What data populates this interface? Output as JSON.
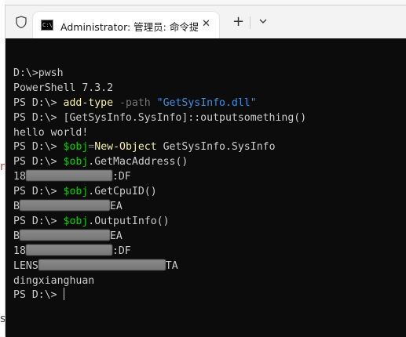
{
  "window": {
    "tab_title": "Administrator: 管理员: 命令提",
    "tab_icon_text": "C:\\."
  },
  "background": {
    "glyph_top": "n",
    "glyph_bottom": "s"
  },
  "terminal": {
    "lines": [
      {
        "segments": [
          {
            "t": "",
            "c": ""
          }
        ]
      },
      {
        "segments": [
          {
            "t": "D:\\>pwsh",
            "c": ""
          }
        ]
      },
      {
        "segments": [
          {
            "t": "PowerShell 7.3.2",
            "c": ""
          }
        ]
      },
      {
        "segments": [
          {
            "t": "PS D:\\> ",
            "c": ""
          },
          {
            "t": "add-type",
            "c": "yellow"
          },
          {
            "t": " -path ",
            "c": "gray"
          },
          {
            "t": "\"GetSysInfo.dll\"",
            "c": "blue"
          }
        ]
      },
      {
        "segments": [
          {
            "t": "PS D:\\> [GetSysInfo.SysInfo]::outputsomething()",
            "c": ""
          }
        ]
      },
      {
        "segments": [
          {
            "t": "hello world!",
            "c": ""
          }
        ]
      },
      {
        "segments": [
          {
            "t": "PS D:\\> ",
            "c": ""
          },
          {
            "t": "$obj",
            "c": "green"
          },
          {
            "t": "=",
            "c": "gray"
          },
          {
            "t": "New-Object",
            "c": "yellow"
          },
          {
            "t": " GetSysInfo.SysInfo",
            "c": ""
          }
        ]
      },
      {
        "segments": [
          {
            "t": "PS D:\\> ",
            "c": ""
          },
          {
            "t": "$obj",
            "c": "green"
          },
          {
            "t": ".GetMacAddress()",
            "c": ""
          }
        ]
      },
      {
        "segments": [
          {
            "t": "18",
            "c": ""
          },
          {
            "blur": 110
          },
          {
            "t": ":DF",
            "c": ""
          }
        ]
      },
      {
        "segments": [
          {
            "t": "PS D:\\> ",
            "c": ""
          },
          {
            "t": "$obj",
            "c": "green"
          },
          {
            "t": ".GetCpuID()",
            "c": ""
          }
        ]
      },
      {
        "segments": [
          {
            "t": "B",
            "c": ""
          },
          {
            "blur": 115
          },
          {
            "t": "EA",
            "c": ""
          }
        ]
      },
      {
        "segments": [
          {
            "t": "PS D:\\> ",
            "c": ""
          },
          {
            "t": "$obj",
            "c": "green"
          },
          {
            "t": ".OutputInfo()",
            "c": ""
          }
        ]
      },
      {
        "segments": [
          {
            "t": "B",
            "c": ""
          },
          {
            "blur": 115
          },
          {
            "t": "EA",
            "c": ""
          }
        ]
      },
      {
        "segments": [
          {
            "t": "18",
            "c": ""
          },
          {
            "blur": 110
          },
          {
            "t": ":DF",
            "c": ""
          }
        ]
      },
      {
        "segments": [
          {
            "t": "LENS",
            "c": ""
          },
          {
            "blur": 162
          },
          {
            "t": "TA",
            "c": ""
          }
        ]
      },
      {
        "segments": [
          {
            "t": "dingxianghuan",
            "c": ""
          }
        ]
      },
      {
        "segments": [
          {
            "t": "PS D:\\> ",
            "c": ""
          },
          {
            "cursor": true
          }
        ]
      }
    ]
  },
  "icons": {
    "shield": "shield-icon",
    "close": "close-icon",
    "new_tab": "plus-icon",
    "dropdown": "chevron-down-icon"
  }
}
